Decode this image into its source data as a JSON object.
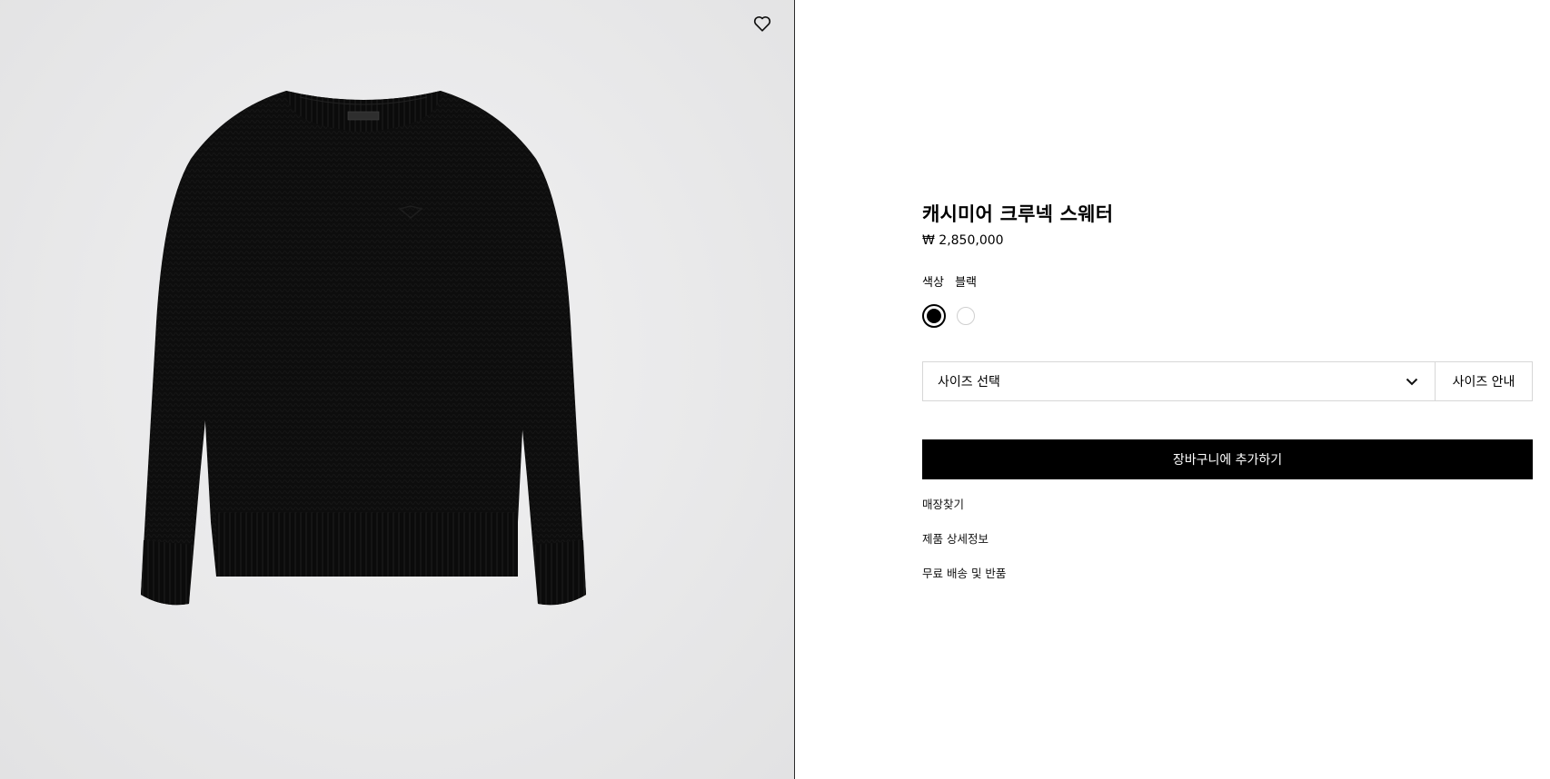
{
  "product": {
    "title": "캐시미어 크루넥 스웨터",
    "price": "₩ 2,850,000",
    "image_icon": "sweater-image"
  },
  "wishlist": {
    "icon": "heart-icon"
  },
  "color": {
    "label": "색상",
    "selected": "블랙",
    "options": [
      {
        "name": "블랙",
        "hex": "#000000"
      },
      {
        "name": "화이트",
        "hex": "#ffffff"
      }
    ]
  },
  "size": {
    "placeholder": "사이즈 선택",
    "chevron_icon": "chevron-down-icon",
    "guide_label": "사이즈 안내"
  },
  "cart": {
    "add_label": "장바구니에 추가하기"
  },
  "links": [
    {
      "label": "매장찾기"
    },
    {
      "label": "제품 상세정보"
    },
    {
      "label": "무료 배송 및 반품"
    }
  ],
  "colors": {
    "image_background": "#e9e9ea",
    "button_bg": "#000000",
    "button_text": "#ffffff",
    "border": "#d7d7d7"
  }
}
